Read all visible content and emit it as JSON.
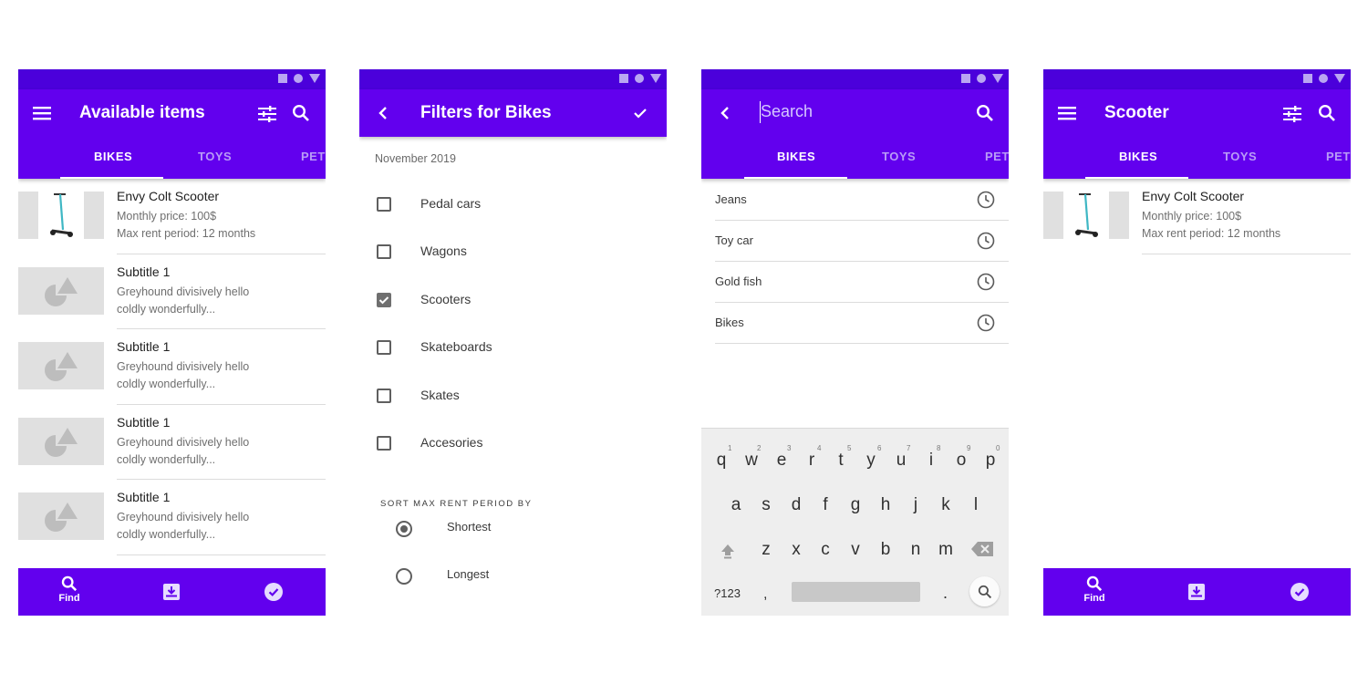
{
  "colors": {
    "primary": "#6200ee",
    "status_bar": "#4b00db",
    "tab_inactive": "#b99cf7"
  },
  "screen1": {
    "title": "Available items",
    "tabs": [
      {
        "label": "BIKES"
      },
      {
        "label": "TOYS"
      },
      {
        "label": "PET"
      }
    ],
    "items": [
      {
        "title": "Envy Colt Scooter",
        "line1": "Monthly price: 100$",
        "line2": "Max rent period: 12 months",
        "thumb": "scooter-image"
      },
      {
        "title": "Subtitle 1",
        "line1": "Greyhound divisively hello",
        "line2": "coldly wonderfully...",
        "thumb": "placeholder-image"
      },
      {
        "title": "Subtitle 1",
        "line1": "Greyhound divisively hello",
        "line2": "coldly wonderfully...",
        "thumb": "placeholder-image"
      },
      {
        "title": "Subtitle 1",
        "line1": "Greyhound divisively hello",
        "line2": "coldly wonderfully...",
        "thumb": "placeholder-image"
      },
      {
        "title": "Subtitle 1",
        "line1": "Greyhound divisively hello",
        "line2": "coldly wonderfully...",
        "thumb": "placeholder-image"
      }
    ],
    "bottom_nav": {
      "find_label": "Find"
    }
  },
  "screen2": {
    "title": "Filters for Bikes",
    "month": "November 2019",
    "categories": [
      {
        "label": "Pedal cars",
        "checked": false
      },
      {
        "label": "Wagons",
        "checked": false
      },
      {
        "label": "Scooters",
        "checked": true
      },
      {
        "label": "Skateboards",
        "checked": false
      },
      {
        "label": "Skates",
        "checked": false
      },
      {
        "label": "Accesories",
        "checked": false
      }
    ],
    "sort_title": "SORT MAX RENT PERIOD BY",
    "sort_options": [
      {
        "label": "Shortest",
        "selected": true
      },
      {
        "label": "Longest",
        "selected": false
      }
    ]
  },
  "screen3": {
    "search_placeholder": "Search",
    "tabs": [
      {
        "label": "BIKES"
      },
      {
        "label": "TOYS"
      },
      {
        "label": "PET"
      }
    ],
    "history": [
      {
        "label": "Jeans"
      },
      {
        "label": "Toy car"
      },
      {
        "label": "Gold fish"
      },
      {
        "label": "Bikes"
      }
    ],
    "keyboard": {
      "row1": [
        "q",
        "w",
        "e",
        "r",
        "t",
        "y",
        "u",
        "i",
        "o",
        "p"
      ],
      "row1_nums": [
        "1",
        "2",
        "3",
        "4",
        "5",
        "6",
        "7",
        "8",
        "9",
        "0"
      ],
      "row2": [
        "a",
        "s",
        "d",
        "f",
        "g",
        "h",
        "j",
        "k",
        "l"
      ],
      "row3": [
        "z",
        "x",
        "c",
        "v",
        "b",
        "n",
        "m"
      ],
      "symbols_label": "?123",
      "comma": ",",
      "period": "."
    }
  },
  "screen4": {
    "title": "Scooter",
    "tabs": [
      {
        "label": "BIKES"
      },
      {
        "label": "TOYS"
      },
      {
        "label": "PET"
      }
    ],
    "items": [
      {
        "title": "Envy Colt Scooter",
        "line1": "Monthly price: 100$",
        "line2": "Max rent period: 12 months",
        "thumb": "scooter-image"
      }
    ],
    "bottom_nav": {
      "find_label": "Find"
    }
  }
}
